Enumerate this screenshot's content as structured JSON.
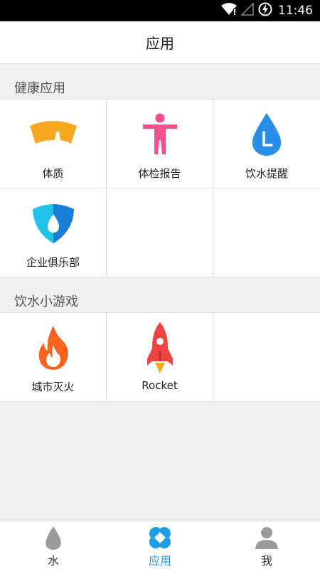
{
  "status_bar": {
    "time": "11:46",
    "icons": [
      "wifi-icon",
      "signal-icon",
      "battery-charging-icon"
    ]
  },
  "header": {
    "title": "应用"
  },
  "sections": [
    {
      "title": "健康应用",
      "apps": [
        {
          "label": "体质",
          "icon": "scale-icon",
          "color": "#f7a823"
        },
        {
          "label": "体检报告",
          "icon": "person-icon",
          "color": "#f2508f"
        },
        {
          "label": "饮水提醒",
          "icon": "water-clock-icon",
          "color": "#2a8fe6"
        },
        {
          "label": "企业俱乐部",
          "icon": "shield-drop-icon",
          "color": "#1ec3e8"
        }
      ]
    },
    {
      "title": "饮水小游戏",
      "apps": [
        {
          "label": "城市灭火",
          "icon": "flame-icon",
          "color": "#f7621c"
        },
        {
          "label": "Rocket",
          "icon": "rocket-icon",
          "color": "#ee4441"
        }
      ]
    }
  ],
  "bottom_nav": [
    {
      "label": "水",
      "icon": "water-drop-icon",
      "active": false
    },
    {
      "label": "应用",
      "icon": "apps-icon",
      "active": true
    },
    {
      "label": "我",
      "icon": "user-icon",
      "active": false
    }
  ],
  "colors": {
    "accent": "#1f9ee6",
    "background": "#f0f0f0"
  }
}
